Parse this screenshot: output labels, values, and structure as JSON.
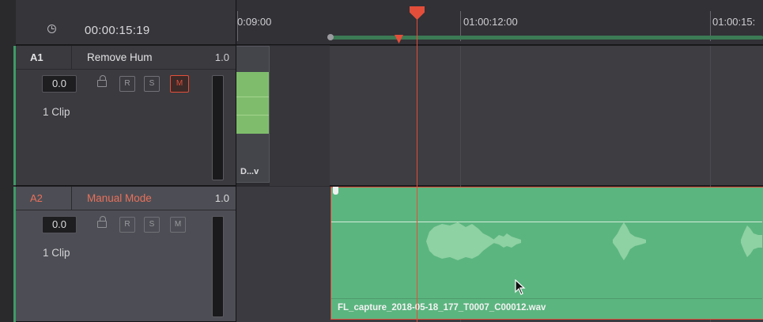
{
  "timecode": "00:00:15:19",
  "ruler": {
    "labels": [
      "0:09:00",
      "01:00:12:00",
      "01:00:15:"
    ]
  },
  "tracks": [
    {
      "id": "A1",
      "name": "Remove Hum",
      "gain": "1.0",
      "volume": "0.0",
      "buttons": {
        "record": "R",
        "solo": "S",
        "mute": "M"
      },
      "mute_active": true,
      "clip_count": "1 Clip",
      "clip_name": "D...v"
    },
    {
      "id": "A2",
      "name": "Manual Mode",
      "gain": "1.0",
      "volume": "0.0",
      "buttons": {
        "record": "R",
        "solo": "S",
        "mute": "M"
      },
      "mute_active": false,
      "clip_count": "1 Clip",
      "clip_name": "FL_capture_2018-05-18_177_T0007_C00012.wav",
      "selected": true
    }
  ],
  "colors": {
    "playhead": "#e34e3a",
    "clip_audio": "#5bb57f",
    "clip_waveform": "#8ed1a3",
    "track_name_selected": "#e8705b"
  },
  "icons": [
    "clock-icon",
    "lock-icon",
    "playhead-icon",
    "mouse-cursor-icon"
  ]
}
